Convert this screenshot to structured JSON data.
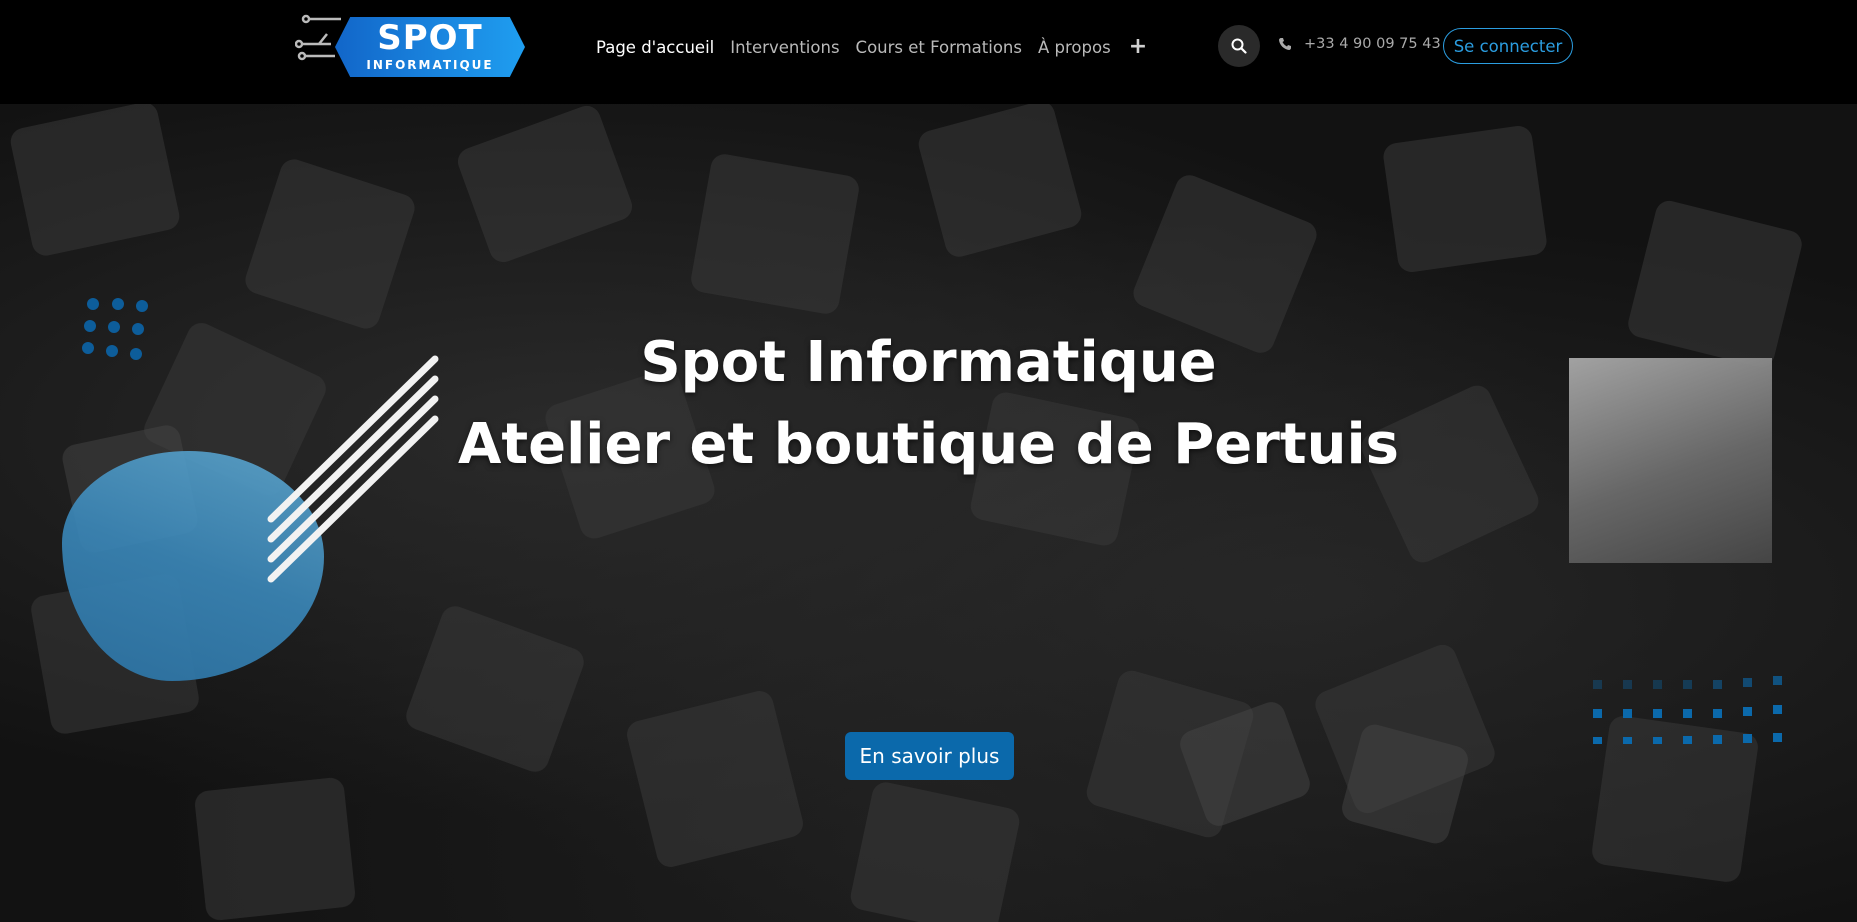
{
  "brand": {
    "name": "SPOT",
    "tagline": "INFORMATIQUE"
  },
  "nav": {
    "items": [
      {
        "label": "Page d'accueil",
        "active": true
      },
      {
        "label": "Interventions",
        "active": false
      },
      {
        "label": "Cours et Formations",
        "active": false
      },
      {
        "label": "À propos",
        "active": false
      }
    ],
    "more_icon": "plus-icon",
    "search_icon": "search-icon"
  },
  "contact": {
    "phone_icon": "phone-icon",
    "phone": "+33 4 90 09 75 43"
  },
  "login": {
    "label": "Se connecter"
  },
  "hero": {
    "title_line1": "Spot Informatique",
    "title_line2": "Atelier et boutique de Pertuis",
    "cta_label": "En savoir plus"
  },
  "colors": {
    "accent": "#0b69ab",
    "link_blue": "#2b9de0",
    "background": "#000000",
    "blob": "#3a86b7"
  }
}
